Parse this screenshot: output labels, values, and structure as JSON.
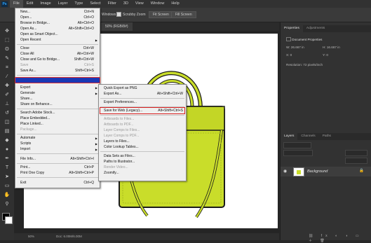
{
  "menubar": {
    "logo": "Ps",
    "items": [
      "File",
      "Edit",
      "Image",
      "Layer",
      "Type",
      "Select",
      "Filter",
      "3D",
      "View",
      "Window",
      "Help"
    ]
  },
  "options": {
    "checkbox1": "Windows",
    "checkbox2": "Scrubby Zoom",
    "button1": "Fit Screen",
    "button2": "Fill Screen"
  },
  "document": {
    "tab_title": "50% (RGB/8#)",
    "zoom": "50%",
    "doc_info": "Doc: 6.00M/6.00M"
  },
  "file_menu": [
    {
      "label": "New...",
      "shortcut": "Ctrl+N"
    },
    {
      "label": "Open...",
      "shortcut": "Ctrl+O"
    },
    {
      "label": "Browse in Bridge...",
      "shortcut": "Alt+Ctrl+O"
    },
    {
      "label": "Open As...",
      "shortcut": "Alt+Shift+Ctrl+O"
    },
    {
      "label": "Open as Smart Object...",
      "shortcut": ""
    },
    {
      "label": "Open Recent",
      "shortcut": "",
      "submenu": true
    },
    {
      "label": "Close",
      "shortcut": "Ctrl+W"
    },
    {
      "label": "Close All",
      "shortcut": "Alt+Ctrl+W"
    },
    {
      "label": "Close and Go to Bridge...",
      "shortcut": "Shift+Ctrl+W"
    },
    {
      "label": "Save",
      "shortcut": "Ctrl+S"
    },
    {
      "label": "Save As...",
      "shortcut": "Shift+Ctrl+S"
    },
    {
      "label": "Export",
      "shortcut": "",
      "submenu": true
    },
    {
      "label": "Generate",
      "shortcut": "",
      "submenu": true
    },
    {
      "label": "Share...",
      "shortcut": ""
    },
    {
      "label": "Share on Behance...",
      "shortcut": ""
    },
    {
      "label": "Search Adobe Stock...",
      "shortcut": ""
    },
    {
      "label": "Place Embedded...",
      "shortcut": ""
    },
    {
      "label": "Place Linked...",
      "shortcut": ""
    },
    {
      "label": "Package...",
      "shortcut": ""
    },
    {
      "label": "Automate",
      "shortcut": "",
      "submenu": true
    },
    {
      "label": "Scripts",
      "shortcut": "",
      "submenu": true
    },
    {
      "label": "Import",
      "shortcut": "",
      "submenu": true
    },
    {
      "label": "File Info...",
      "shortcut": "Alt+Shift+Ctrl+I"
    },
    {
      "label": "Print...",
      "shortcut": "Ctrl+P"
    },
    {
      "label": "Print One Copy",
      "shortcut": "Alt+Shift+Ctrl+P"
    },
    {
      "label": "Exit",
      "shortcut": "Ctrl+Q"
    }
  ],
  "export_menu": [
    {
      "label": "Quick Export as PNG",
      "shortcut": ""
    },
    {
      "label": "Export As...",
      "shortcut": "Alt+Shift+Ctrl+W"
    },
    {
      "label": "Export Preferences...",
      "shortcut": ""
    },
    {
      "label": "Save for Web (Legacy)...",
      "shortcut": "Alt+Shift+Ctrl+S"
    },
    {
      "label": "Artboards to Files...",
      "shortcut": ""
    },
    {
      "label": "Artboards to PDF...",
      "shortcut": ""
    },
    {
      "label": "Layer Comps to Files...",
      "shortcut": ""
    },
    {
      "label": "Layer Comps to PDF...",
      "shortcut": ""
    },
    {
      "label": "Layers to Files...",
      "shortcut": ""
    },
    {
      "label": "Color Lookup Tables...",
      "shortcut": ""
    },
    {
      "label": "Data Sets as Files...",
      "shortcut": ""
    },
    {
      "label": "Paths to Illustrator...",
      "shortcut": ""
    },
    {
      "label": "Render Video...",
      "shortcut": ""
    },
    {
      "label": "Zoomify...",
      "shortcut": ""
    }
  ],
  "properties": {
    "tab1": "Properties",
    "tab2": "Adjustments",
    "section": "Document Properties",
    "w_label": "W:",
    "w_value": "26.667 in",
    "h_label": "H:",
    "h_value": "16.667 in",
    "x_label": "X:",
    "x_value": "0",
    "y_label": "Y:",
    "y_value": "0",
    "resolution": "Resolution: 72 pixels/inch"
  },
  "layers": {
    "tab1": "Layers",
    "tab2": "Channels",
    "tab3": "Paths",
    "layer_name": "Background"
  },
  "colors": {
    "bag": "#c9dd2a",
    "menu_highlight": "#1a37b4",
    "red_outline": "#d82020"
  }
}
